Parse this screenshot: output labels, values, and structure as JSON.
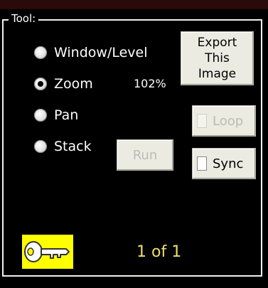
{
  "tool_group": {
    "title": "Tool:",
    "options": [
      {
        "label": "Window/Level",
        "checked": false
      },
      {
        "label": "Zoom",
        "checked": true
      },
      {
        "label": "Pan",
        "checked": false
      },
      {
        "label": "Stack",
        "checked": false
      }
    ],
    "zoom_value": "102%"
  },
  "buttons": {
    "export": {
      "line1": "Export",
      "line2": "This",
      "line3": "Image"
    },
    "run": "Run",
    "loop": "Loop",
    "sync": "Sync"
  },
  "footer": {
    "counter": "1 of 1",
    "key_icon_color": "#ffff00"
  }
}
